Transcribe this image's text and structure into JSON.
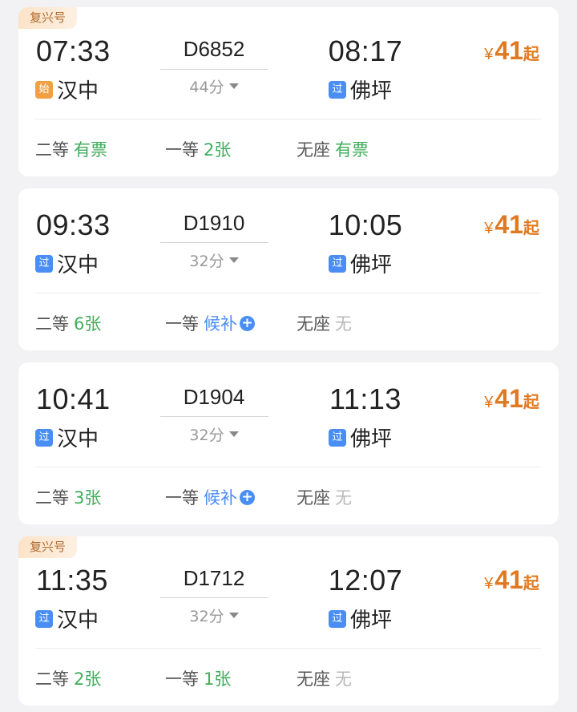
{
  "trains": [
    {
      "tag": "复兴号",
      "dep_time": "07:33",
      "dep_station": "汉中",
      "dep_badge": "始",
      "train_no": "D6852",
      "duration": "44分",
      "arr_time": "08:17",
      "arr_station": "佛坪",
      "arr_badge": "过",
      "price_symbol": "¥",
      "price": "41",
      "price_suffix": "起",
      "seats": [
        {
          "label": "二等",
          "status": "有票"
        },
        {
          "label": "一等",
          "status": "2张"
        },
        {
          "label": "无座",
          "status": "有票"
        }
      ]
    },
    {
      "tag": "",
      "dep_time": "09:33",
      "dep_station": "汉中",
      "dep_badge": "过",
      "train_no": "D1910",
      "duration": "32分",
      "arr_time": "10:05",
      "arr_station": "佛坪",
      "arr_badge": "过",
      "price_symbol": "¥",
      "price": "41",
      "price_suffix": "起",
      "seats": [
        {
          "label": "二等",
          "status": "6张"
        },
        {
          "label": "一等",
          "status": "候补"
        },
        {
          "label": "无座",
          "status": "无"
        }
      ]
    },
    {
      "tag": "",
      "dep_time": "10:41",
      "dep_station": "汉中",
      "dep_badge": "过",
      "train_no": "D1904",
      "duration": "32分",
      "arr_time": "11:13",
      "arr_station": "佛坪",
      "arr_badge": "过",
      "price_symbol": "¥",
      "price": "41",
      "price_suffix": "起",
      "seats": [
        {
          "label": "二等",
          "status": "3张"
        },
        {
          "label": "一等",
          "status": "候补"
        },
        {
          "label": "无座",
          "status": "无"
        }
      ]
    },
    {
      "tag": "复兴号",
      "dep_time": "11:35",
      "dep_station": "汉中",
      "dep_badge": "过",
      "train_no": "D1712",
      "duration": "32分",
      "arr_time": "12:07",
      "arr_station": "佛坪",
      "arr_badge": "过",
      "price_symbol": "¥",
      "price": "41",
      "price_suffix": "起",
      "seats": [
        {
          "label": "二等",
          "status": "2张"
        },
        {
          "label": "一等",
          "status": "1张"
        },
        {
          "label": "无座",
          "status": "无"
        }
      ]
    }
  ],
  "colors": {
    "available": "#3fad5a",
    "waitlist": "#4a8ef5",
    "unavailable": "#b8b8b8",
    "price": "#e07a21"
  },
  "icons": {
    "waitlist_plus": "plus-circle-icon",
    "duration_toggle": "caret-down-icon"
  }
}
